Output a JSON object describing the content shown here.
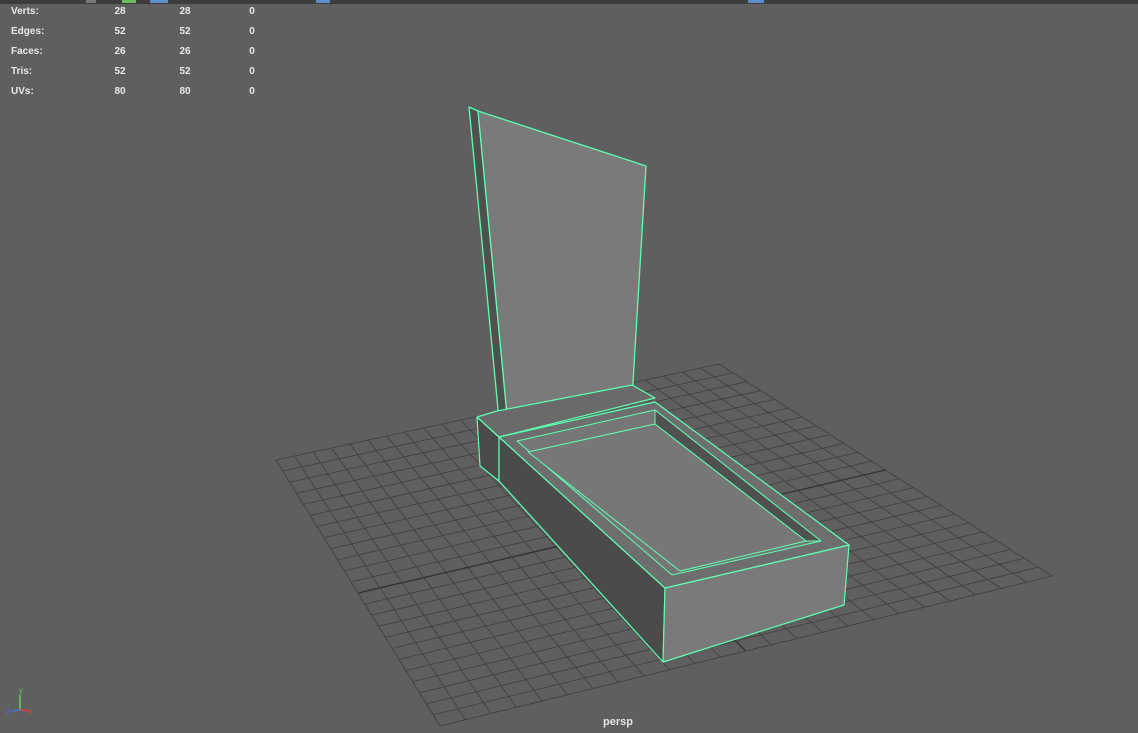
{
  "hud": {
    "rows": [
      {
        "label": "Verts:",
        "v1": "28",
        "v2": "28",
        "v3": "0"
      },
      {
        "label": "Edges:",
        "v1": "52",
        "v2": "52",
        "v3": "0"
      },
      {
        "label": "Faces:",
        "v1": "26",
        "v2": "26",
        "v3": "0"
      },
      {
        "label": "Tris:",
        "v1": "52",
        "v2": "52",
        "v3": "0"
      },
      {
        "label": "UVs:",
        "v1": "80",
        "v2": "80",
        "v3": "0"
      }
    ]
  },
  "viewport": {
    "camera": "persp",
    "background_color": "#5f5f5f",
    "grid_color": "#3f3f3f",
    "selection_wire_color": "#5dffb0"
  },
  "axis_gizmo": {
    "x_label": "x",
    "y_label": "y",
    "z_label": "z",
    "x_color": "#e04040",
    "y_color": "#5ad45a",
    "z_color": "#4a6ee0"
  }
}
